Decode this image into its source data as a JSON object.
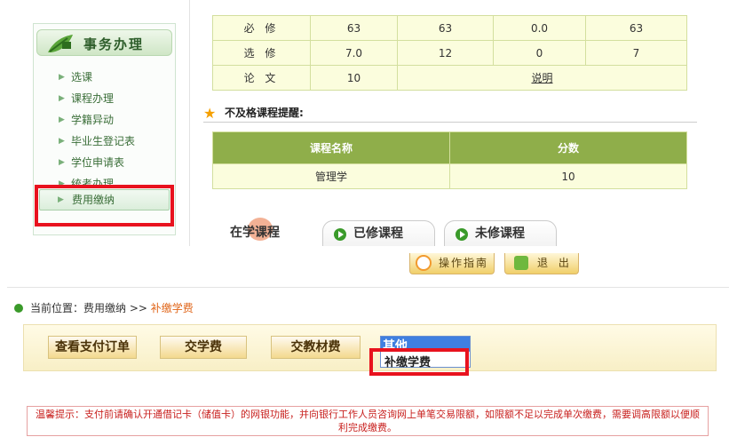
{
  "sidebar": {
    "title": "事务办理",
    "items": [
      {
        "label": "选课"
      },
      {
        "label": "课程办理"
      },
      {
        "label": "学籍异动"
      },
      {
        "label": "毕业生登记表"
      },
      {
        "label": "学位申请表"
      },
      {
        "label": "统考办理"
      },
      {
        "label": "费用缴纳"
      }
    ]
  },
  "credits": {
    "rows": [
      {
        "label": "必 修",
        "c1": "63",
        "c2": "63",
        "c3": "0.0",
        "c4": "63"
      },
      {
        "label": "选 修",
        "c1": "7.0",
        "c2": "12",
        "c3": "0",
        "c4": "7"
      },
      {
        "label": "论 文",
        "c1": "10",
        "note": "说明"
      }
    ]
  },
  "fail_section": {
    "title": "不及格课程提醒:",
    "headers": [
      "课程名称",
      "分数"
    ],
    "rows": [
      {
        "course": "管理学",
        "score": "10"
      }
    ]
  },
  "tabs": {
    "current": "在学课程",
    "done": "已修课程",
    "todo": "未修课程"
  },
  "header_buttons": {
    "guide": "操作指南",
    "exit": "退 出"
  },
  "breadcrumb": {
    "prefix": "当前位置：费用缴纳 >> ",
    "current": "补缴学费"
  },
  "actions": {
    "orders": "查看支付订单",
    "tuition": "交学费",
    "materials": "交教材费",
    "dropdown_selected": "其他",
    "dropdown_option": "补缴学费"
  },
  "tip": "温馨提示：支付前请确认开通借记卡（储值卡）的网银功能，并向银行工作人员咨询网上单笔交易限额，如限额不足以完成单次缴费，需要调高限额以便顺利完成缴费。",
  "colors": {
    "accent_green": "#8fae4a",
    "highlight_red": "#e8121e",
    "link_orange": "#e0661a"
  }
}
